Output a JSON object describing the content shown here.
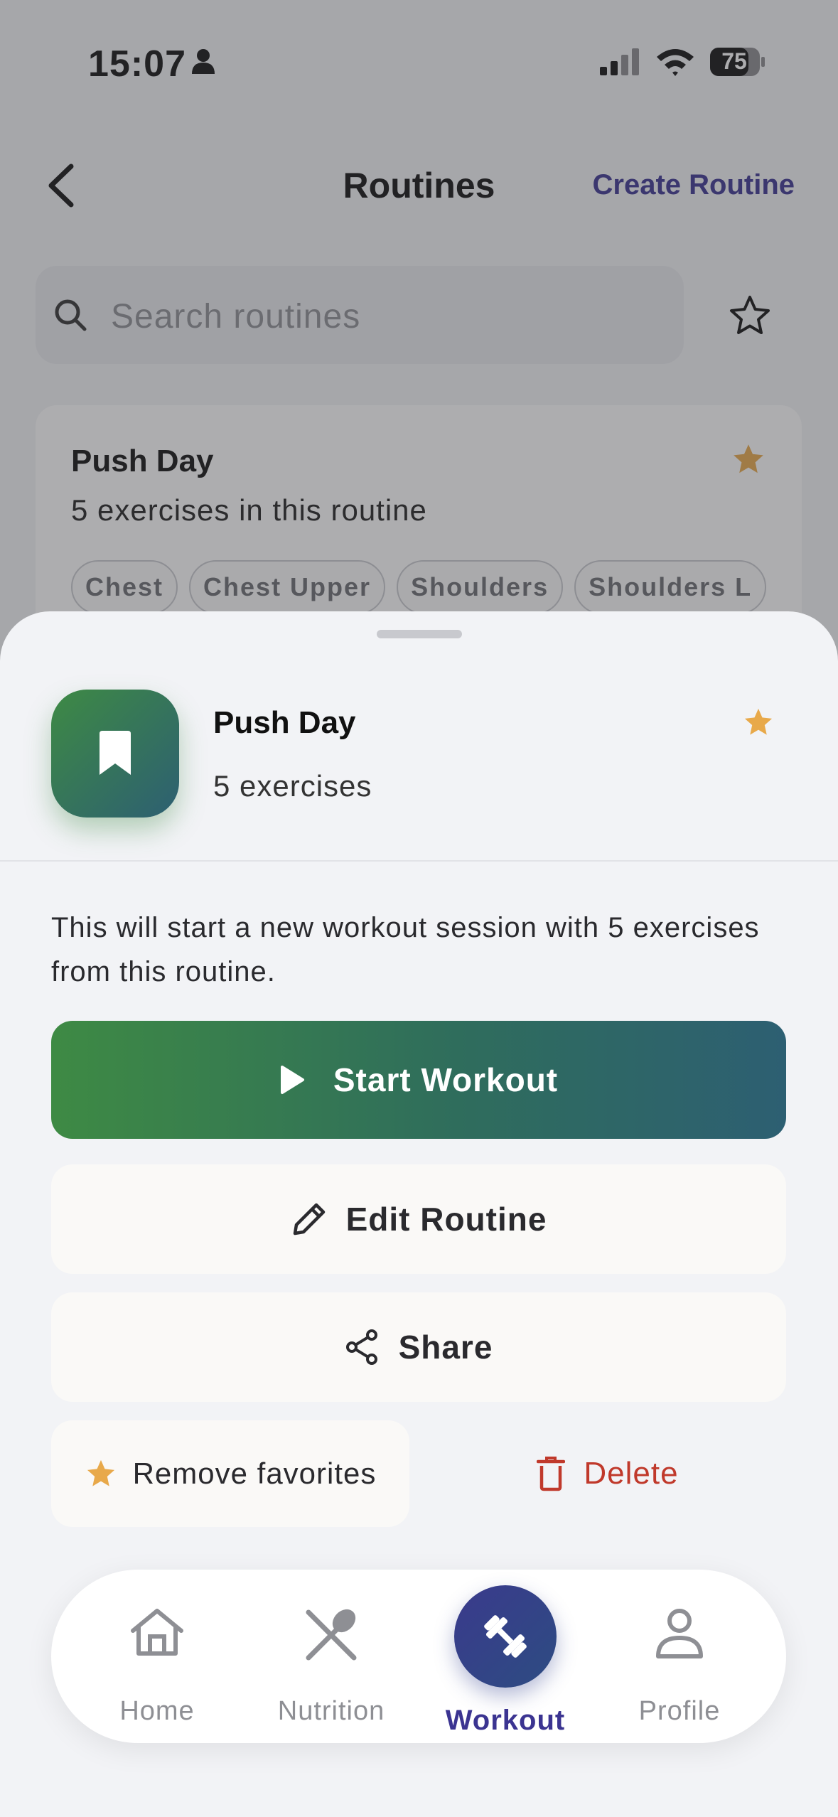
{
  "status_bar": {
    "time": "15:07",
    "battery": "75"
  },
  "nav": {
    "title": "Routines",
    "create_label": "Create Routine"
  },
  "search": {
    "placeholder": "Search routines"
  },
  "background_card": {
    "title": "Push Day",
    "subtitle": "5 exercises in this routine",
    "tags": [
      "Chest",
      "Chest Upper",
      "Shoulders",
      "Shoulders L"
    ]
  },
  "sheet": {
    "title": "Push Day",
    "subtitle": "5 exercises",
    "description": "This will start a new workout session with 5 exercises from this routine.",
    "start_label": "Start Workout",
    "edit_label": "Edit Routine",
    "share_label": "Share",
    "favorite_label": "Remove favorites",
    "delete_label": "Delete"
  },
  "tabs": [
    {
      "label": "Home",
      "icon": "home-icon"
    },
    {
      "label": "Nutrition",
      "icon": "utensils-icon"
    },
    {
      "label": "Workout",
      "icon": "dumbbell-icon",
      "active": true
    },
    {
      "label": "Profile",
      "icon": "person-icon"
    }
  ],
  "colors": {
    "accent_purple": "#3b3491",
    "gradient_green": "#3e8a44",
    "gradient_teal": "#2d5f72",
    "star_gold": "#e8a94a",
    "delete_red": "#c0392b"
  }
}
